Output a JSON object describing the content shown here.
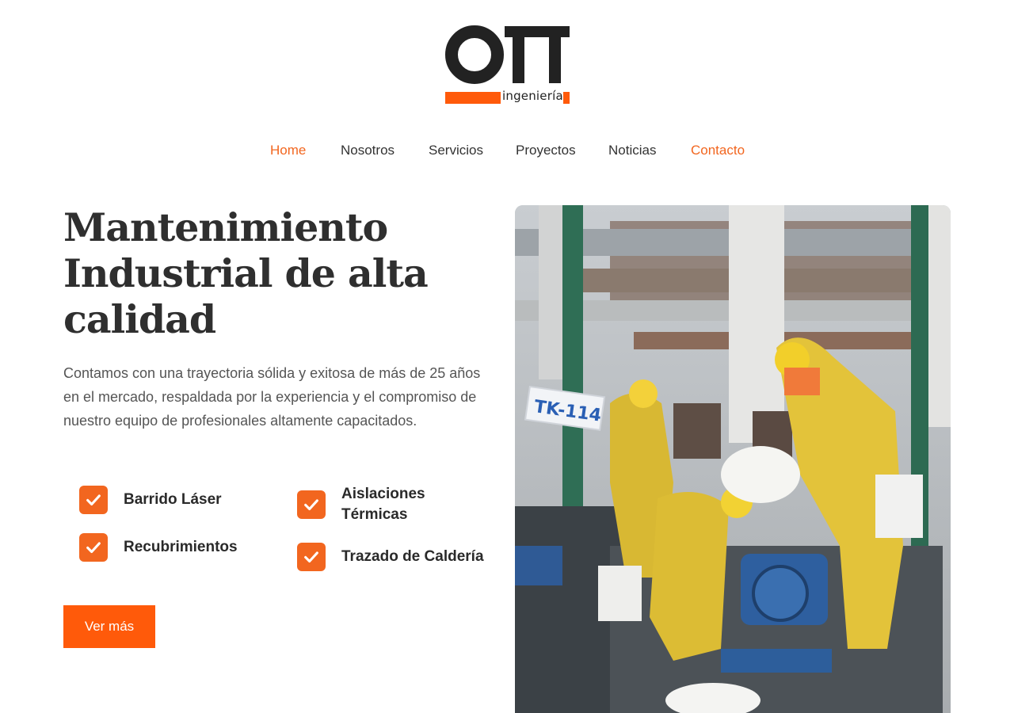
{
  "logo": {
    "mark": "OTT",
    "subtitle": "ingeniería",
    "brand_color": "#ff5a0a"
  },
  "nav": {
    "items": [
      {
        "label": "Home",
        "active": true
      },
      {
        "label": "Nosotros",
        "active": false
      },
      {
        "label": "Servicios",
        "active": false
      },
      {
        "label": "Proyectos",
        "active": false
      },
      {
        "label": "Noticias",
        "active": false
      },
      {
        "label": "Contacto",
        "active": true
      }
    ]
  },
  "hero": {
    "title_lines": [
      "Mantenimiento",
      "Industrial de alta",
      "calidad"
    ],
    "description": "Contamos con una trayectoria sólida y exitosa de más de 25 años en el mercado, respaldada por la experiencia y el compromiso de nuestro equipo de profesionales altamente capacitados.",
    "features": [
      {
        "label": "Barrido Láser",
        "icon": "check-icon"
      },
      {
        "label": "Aislaciones Térmicas",
        "icon": "check-icon"
      },
      {
        "label": "Recubrimientos",
        "icon": "check-icon"
      },
      {
        "label": "Trazado de Caldería",
        "icon": "check-icon"
      }
    ],
    "cta_label": "Ver más",
    "photo_tag": "TK-114"
  },
  "colors": {
    "accent": "#f2661f",
    "button": "#ff5a0a",
    "text": "#2f2f2f"
  }
}
